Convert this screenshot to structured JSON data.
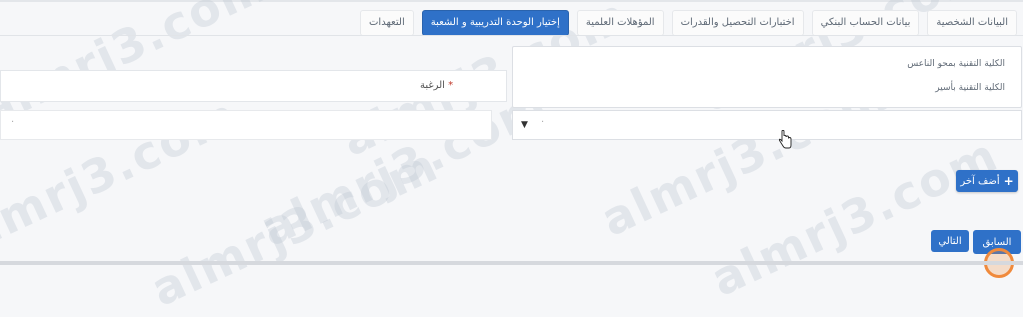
{
  "tabs": [
    {
      "label": "البيانات الشخصية",
      "active": false
    },
    {
      "label": "بيانات الحساب البنكي",
      "active": false
    },
    {
      "label": "اختبارات التحصيل والقدرات",
      "active": false
    },
    {
      "label": "المؤهلات العلمية",
      "active": false
    },
    {
      "label": "إختيار الوحدة التدريبية و الشعبة",
      "active": true
    },
    {
      "label": "التعهدات",
      "active": false
    }
  ],
  "panel": {
    "option1": "الكلية التقنية بمحو الناعس",
    "option2": "الكلية التقنية بأسير"
  },
  "field": {
    "label": "الرغبة",
    "required_mark": "*"
  },
  "select": {
    "right_placeholder": "·",
    "left_placeholder": "·"
  },
  "buttons": {
    "add_row": "أضف آخر",
    "add_plus": "+",
    "previous": "السابق",
    "next": "التالي"
  },
  "watermark": "almrj3.com",
  "colors": {
    "accent": "#2f71c8",
    "click_ring": "#f08a3c"
  }
}
